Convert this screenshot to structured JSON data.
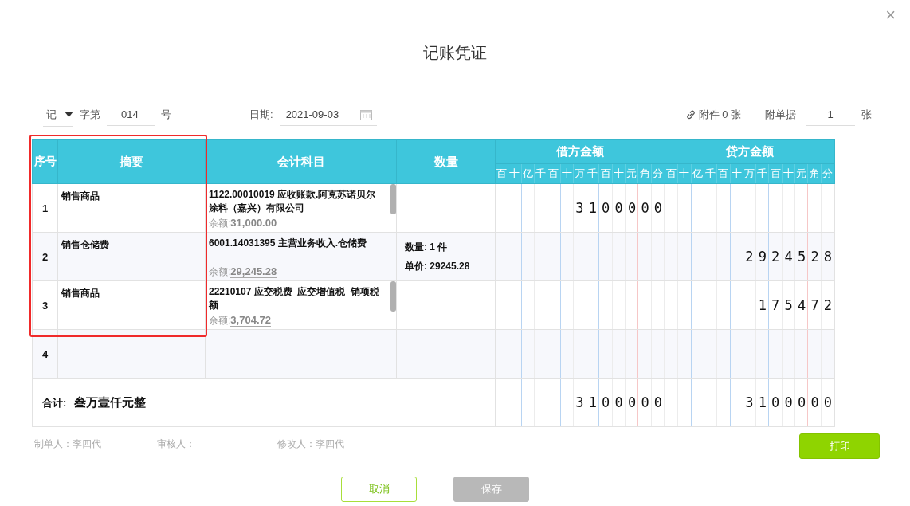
{
  "dialog": {
    "title": "记账凭证",
    "close": "×"
  },
  "toolbar": {
    "voucher_type": "记",
    "word_label": "字第",
    "number": "014",
    "number_suffix": "号",
    "date_label": "日期:",
    "date": "2021-09-03",
    "attachment": "附件 0 张",
    "docs_label": "附单据",
    "docs": "1",
    "docs_suffix": "张"
  },
  "table": {
    "columns": [
      "序号",
      "摘要",
      "会计科目",
      "数量"
    ],
    "debit_heading": "借方金额",
    "credit_heading": "贷方金额",
    "debit_units": [
      "百",
      "十",
      "亿",
      "千",
      "百",
      "十",
      "万",
      "千",
      "百",
      "十",
      "元",
      "角",
      "分"
    ],
    "credit_units": [
      "百",
      "十",
      "亿",
      "千",
      "百",
      "十",
      "万",
      "千",
      "百",
      "十",
      "元",
      "角",
      "分"
    ],
    "rows": [
      {
        "index": "1",
        "summary": "销售商品",
        "account": "1122.00010019 应收账款.阿克苏诺贝尔涂料（嘉兴）有限公司",
        "balance_label": "余额:",
        "balance": "31,000.00",
        "scrollbar": true,
        "quantity": null,
        "debit": "3100000",
        "credit": null
      },
      {
        "index": "2",
        "summary": "销售仓储费",
        "account": "6001.14031395 主营业务收入.仓储费",
        "balance_label": "余额:",
        "balance": "29,245.28",
        "scrollbar": false,
        "quantity": {
          "qty_label": "数量:",
          "qty": "1 件",
          "price_label": "单价:",
          "price": "29245.28"
        },
        "debit": null,
        "credit": "2924528"
      },
      {
        "index": "3",
        "summary": "销售商品",
        "account": "22210107 应交税费_应交增值税_销项税额",
        "balance_label": "余额:",
        "balance": "3,704.72",
        "scrollbar": true,
        "quantity": null,
        "debit": null,
        "credit": "175472"
      },
      {
        "index": "4",
        "summary": null,
        "account": null,
        "balance_label": null,
        "balance": null,
        "scrollbar": false,
        "quantity": null,
        "debit": null,
        "credit": null
      }
    ],
    "total": {
      "label": "合计:",
      "amount_words": "叁万壹仟元整",
      "debit": "3100000",
      "credit": "3100000"
    }
  },
  "footer": {
    "maker": "制单人：李四代",
    "reviewer": "审核人：",
    "modifier": "修改人：李四代",
    "print": "打印"
  },
  "buttons": [
    {
      "label": "取消",
      "disabled": false
    },
    {
      "label": "保存",
      "disabled": true
    }
  ]
}
